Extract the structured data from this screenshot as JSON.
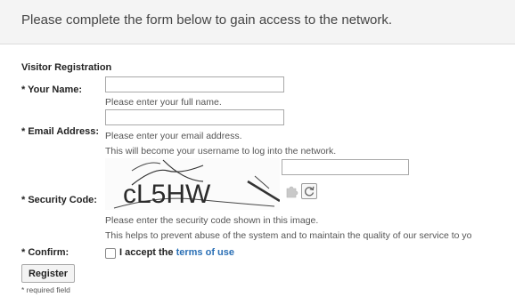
{
  "header": {
    "message": "Please complete the form below to gain access to the network."
  },
  "form": {
    "section_title": "Visitor Registration",
    "name": {
      "label": "* Your Name:",
      "value": "",
      "hint": "Please enter your full name."
    },
    "email": {
      "label": "* Email Address:",
      "value": "",
      "hint_line1": "Please enter your email address.",
      "hint_line2": "This will become your username to log into the network."
    },
    "security": {
      "label": "* Security Code:",
      "captcha_text": "cL5HW",
      "value": "",
      "hint_line1": "Please enter the security code shown in this image.",
      "hint_line2": "This helps to prevent abuse of the system and to maintain the quality of our service to yo"
    },
    "confirm": {
      "label": "* Confirm:",
      "checked": false,
      "text": "I accept the",
      "terms_link": "terms of use"
    },
    "register_button": "Register",
    "required_note": "* required field"
  },
  "icons": {
    "puzzle": "puzzle-icon",
    "refresh": "refresh-icon"
  },
  "colors": {
    "header_bg": "#f4f4f4",
    "link": "#2a6fb5"
  }
}
